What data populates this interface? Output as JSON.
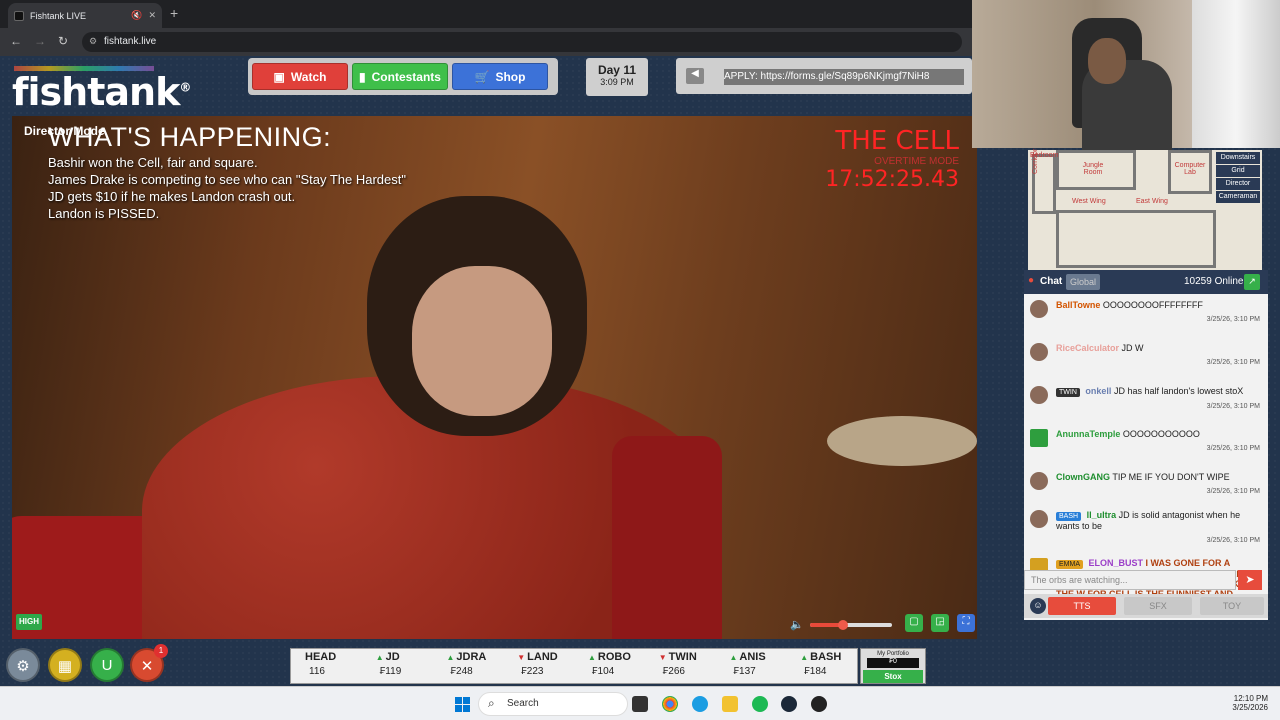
{
  "browser": {
    "tab_title": "Fishtank LIVE",
    "url": "fishtank.live",
    "new_tab": "+"
  },
  "site": {
    "logo": "fishtank",
    "logo_mark": "®",
    "nav": [
      {
        "label": "Watch",
        "icon": "tv-icon"
      },
      {
        "label": "Contestants",
        "icon": "people-icon"
      },
      {
        "label": "Shop",
        "icon": "cart-icon"
      }
    ],
    "day": "Day 11",
    "time": "3:09 PM",
    "apply": "APPLY: https://forms.gle/Sq89p6NKjmgf7NiH8"
  },
  "video": {
    "director_mode": "Director Mode",
    "happening_title": "WHAT'S HAPPENING:",
    "happening_lines": [
      "Bashir won the Cell, fair and square.",
      "James Drake is competing to see who can \"Stay The Hardest\"",
      "JD gets $10 if he makes Landon crash out.",
      "Landon is PISSED."
    ],
    "cell_title": "THE CELL",
    "cell_mode": "OVERTIME MODE",
    "cell_timer": "17:52:25.43",
    "quality": "HIGH",
    "volume_percent": 40
  },
  "map": {
    "rooms": [
      "Bedroom",
      "Jungle Room",
      "Computer Lab",
      "Corridor",
      "West Wing",
      "East Wing"
    ],
    "buttons": [
      "Downstairs",
      "Grid",
      "Director",
      "Cameraman"
    ]
  },
  "chat": {
    "title": "Chat",
    "global": "Global",
    "online": "10259 Online",
    "messages": [
      {
        "user": "BallTowne",
        "text": "OOOOOOOOFFFFFFFF",
        "time": "3/25/26, 3:10 PM",
        "color": "#d35400",
        "tag": ""
      },
      {
        "user": "RiceCalculator",
        "text": "JD W",
        "time": "3/25/26, 3:10 PM",
        "color": "#e8a09a",
        "tag": ""
      },
      {
        "user": "onkell",
        "text": "JD has half landon's lowest stoX",
        "time": "3/25/26, 3:10 PM",
        "color": "#6a7fb0",
        "tag": "TWIN"
      },
      {
        "user": "AnunnaTemple",
        "text": "OOOOOOOOOOO",
        "time": "3/25/26, 3:10 PM",
        "color": "#2e9e3e",
        "tag": ""
      },
      {
        "user": "ClownGANG",
        "text": "TIP ME IF YOU DON'T WIPE",
        "time": "3/25/26, 3:10 PM",
        "color": "#1e8e2e",
        "tag": ""
      },
      {
        "user": "ll_ultra",
        "text": "JD is solid antagonist when he wants to be",
        "time": "3/25/26, 3:10 PM",
        "color": "#1e8e2e",
        "tag": "BASH"
      },
      {
        "user": "ELON_BUST",
        "text": "I WAS GONE FOR A WHILE. IS PRODUCTION STILL SCRAMBLING TO AVOID ADMITTING THAT GIVING DRAKE THE W FOR CELL IS THE FUNNIEST AND MOST INTERESTING OUTCOME?",
        "time": "",
        "color": "#9b3ec8",
        "tag": "EMMA"
      }
    ],
    "input_placeholder": "The orbs are watching...",
    "tts": "TTS",
    "sfx": "SFX",
    "toy": "TOY"
  },
  "stox": {
    "items": [
      {
        "name": "HEAD",
        "price": "116",
        "dir": ""
      },
      {
        "name": "JD",
        "price": "₣119",
        "dir": "up"
      },
      {
        "name": "JDRA",
        "price": "₣248",
        "dir": "up"
      },
      {
        "name": "LAND",
        "price": "₣223",
        "dir": "down"
      },
      {
        "name": "ROBO",
        "price": "₣104",
        "dir": "up"
      },
      {
        "name": "TWIN",
        "price": "₣266",
        "dir": "down"
      },
      {
        "name": "ANIS",
        "price": "₣137",
        "dir": "up"
      },
      {
        "name": "BASH",
        "price": "₣184",
        "dir": "up"
      }
    ],
    "portfolio_label": "My Portfolio",
    "portfolio_value": "₣0",
    "stox_button": "Stox"
  },
  "taskbar": {
    "search": "Search",
    "time": "12:10 PM",
    "date": "3/25/2026"
  },
  "colors": {
    "watch": "#e0403a",
    "contestants": "#3fbf4a",
    "shop": "#3c72d8",
    "cell_red": "#ff2424"
  }
}
